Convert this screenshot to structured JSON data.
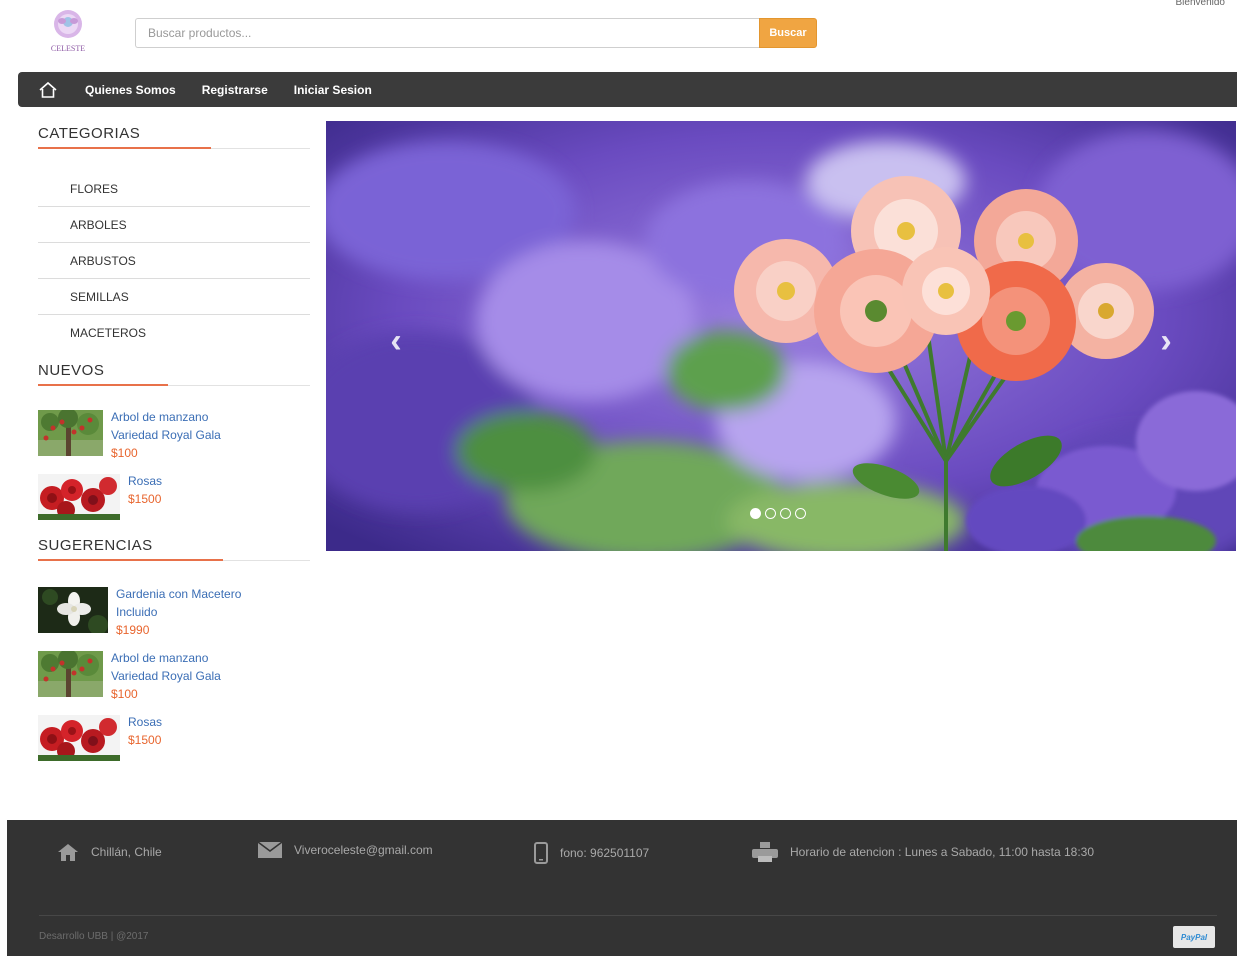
{
  "header": {
    "logo_text": "CELESTE",
    "search_placeholder": "Buscar productos...",
    "search_button": "Buscar",
    "top_right_text": "Bienvenido"
  },
  "nav": {
    "home_icon": "home-icon",
    "links": [
      "Quienes Somos",
      "Registrarse",
      "Iniciar Sesion"
    ]
  },
  "sidebar": {
    "categories_title": "CATEGORIAS",
    "categories": [
      "FLORES",
      "ARBOLES",
      "ARBUSTOS",
      "SEMILLAS",
      "MACETEROS"
    ],
    "nuevos_title": "NUEVOS",
    "nuevos": [
      {
        "name": "Arbol de manzano Variedad Royal Gala",
        "price": "$100",
        "thumb": "apple-tree"
      },
      {
        "name": "Rosas",
        "price": "$1500",
        "thumb": "roses"
      }
    ],
    "sugerencias_title": "SUGERENCIAS",
    "sugerencias": [
      {
        "name": "Gardenia con Macetero Incluido",
        "price": "$1990",
        "thumb": "gardenia"
      },
      {
        "name": "Arbol de manzano Variedad Royal Gala",
        "price": "$100",
        "thumb": "apple-tree"
      },
      {
        "name": "Rosas",
        "price": "$1500",
        "thumb": "roses"
      }
    ]
  },
  "carousel": {
    "prev_icon": "chevron-left-icon",
    "next_icon": "chevron-right-icon",
    "slide_count": 4,
    "active_slide": 1
  },
  "footer": {
    "location": "Chillán, Chile",
    "email": "Viveroceleste@gmail.com",
    "phone": "fono: 962501107",
    "hours": "Horario de atencion : Lunes a Sabado, 11:00 hasta 18:30",
    "copyright": "Desarrollo UBB | @2017",
    "paypal_label": "PayPal"
  },
  "colors": {
    "accent_orange": "#f0a542",
    "link_blue": "#3b6eb5",
    "price_orange": "#e8652e",
    "nav_bg": "#3b3b3b",
    "footer_bg": "#333333"
  }
}
